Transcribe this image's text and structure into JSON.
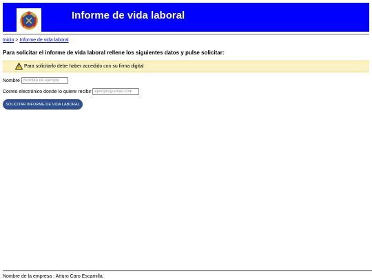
{
  "header": {
    "title": "Informe de vida laboral",
    "logo_icon": "emblem-icon"
  },
  "breadcrumb": {
    "home": "Inicio",
    "separator": ">",
    "current": "Informe de vida laboral"
  },
  "intro": "Para solicitar el informe de vida laboral rellene los siguientes datos y pulse solicitar:",
  "notice": {
    "icon": "warning-icon",
    "text": "Para solicitarlo debe haber accedido con su firma digital"
  },
  "form": {
    "name_label": "Nombre",
    "name_placeholder": "Nombre de ejemplo",
    "email_label": "Correo electrónico donde lo quiere recibir",
    "email_placeholder": "ejemplo@email.com",
    "submit_label": "SOLICITAR INFORME DE VIDA LABORAL"
  },
  "footer": "Nombre de la empresa : Arturo Caro Escamilla.",
  "colors": {
    "header_bg": "#0000ff",
    "notice_bg": "#fbf2c4",
    "button_bg": "#2f4f8f"
  }
}
